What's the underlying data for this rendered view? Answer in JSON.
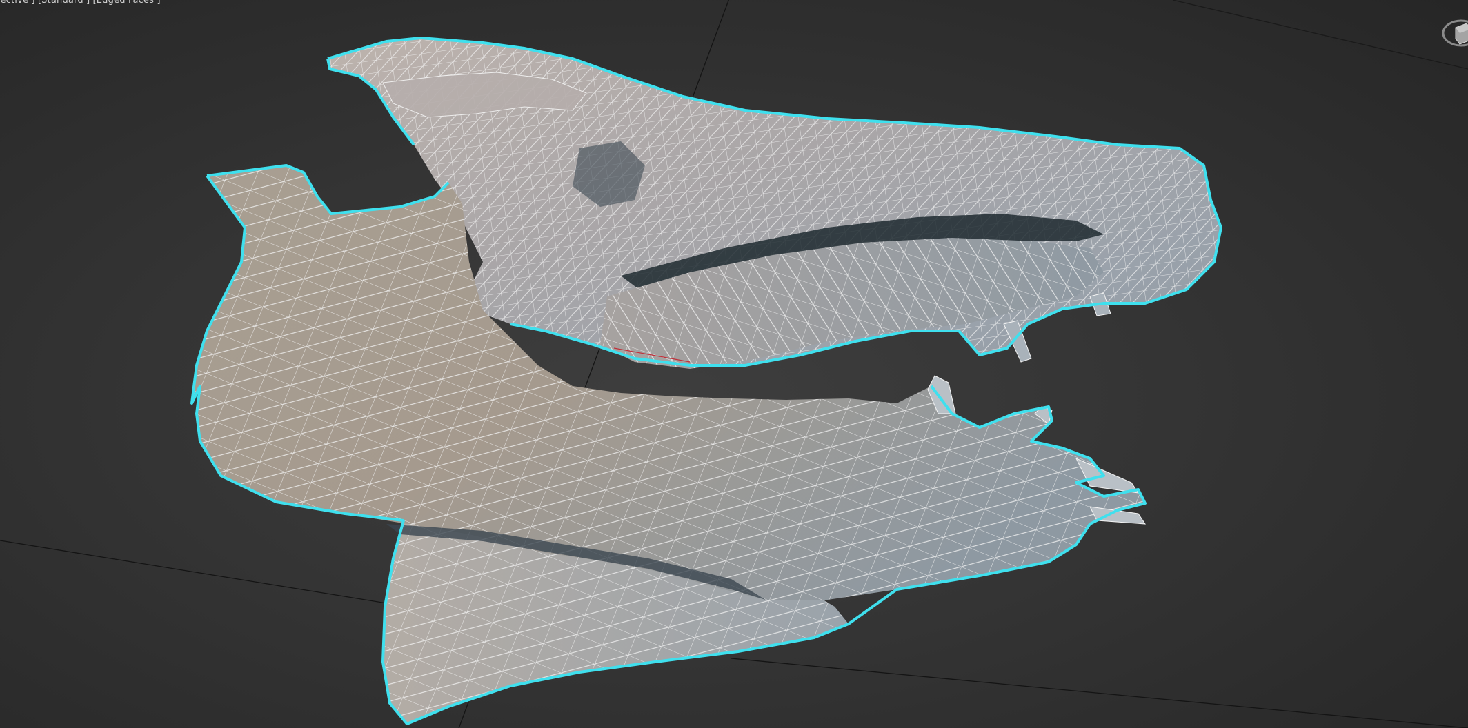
{
  "viewport": {
    "label_parts": {
      "view": "pective ]",
      "shading_mode": "[Standard ]",
      "display_mode": "[Edged Faces ]"
    },
    "colors": {
      "background": "#333333",
      "grid_line": "#141414",
      "selection_outline": "#3fe0ee",
      "wireframe": "#f4f4f4",
      "bone_light": "#b8b0a6",
      "bone_shadow": "#6f7b85",
      "bone_tint": "#c7a9a4"
    },
    "model": {
      "name": "skull",
      "selected": true
    },
    "navigation": {
      "viewcube_icon": "viewcube-icon"
    }
  }
}
